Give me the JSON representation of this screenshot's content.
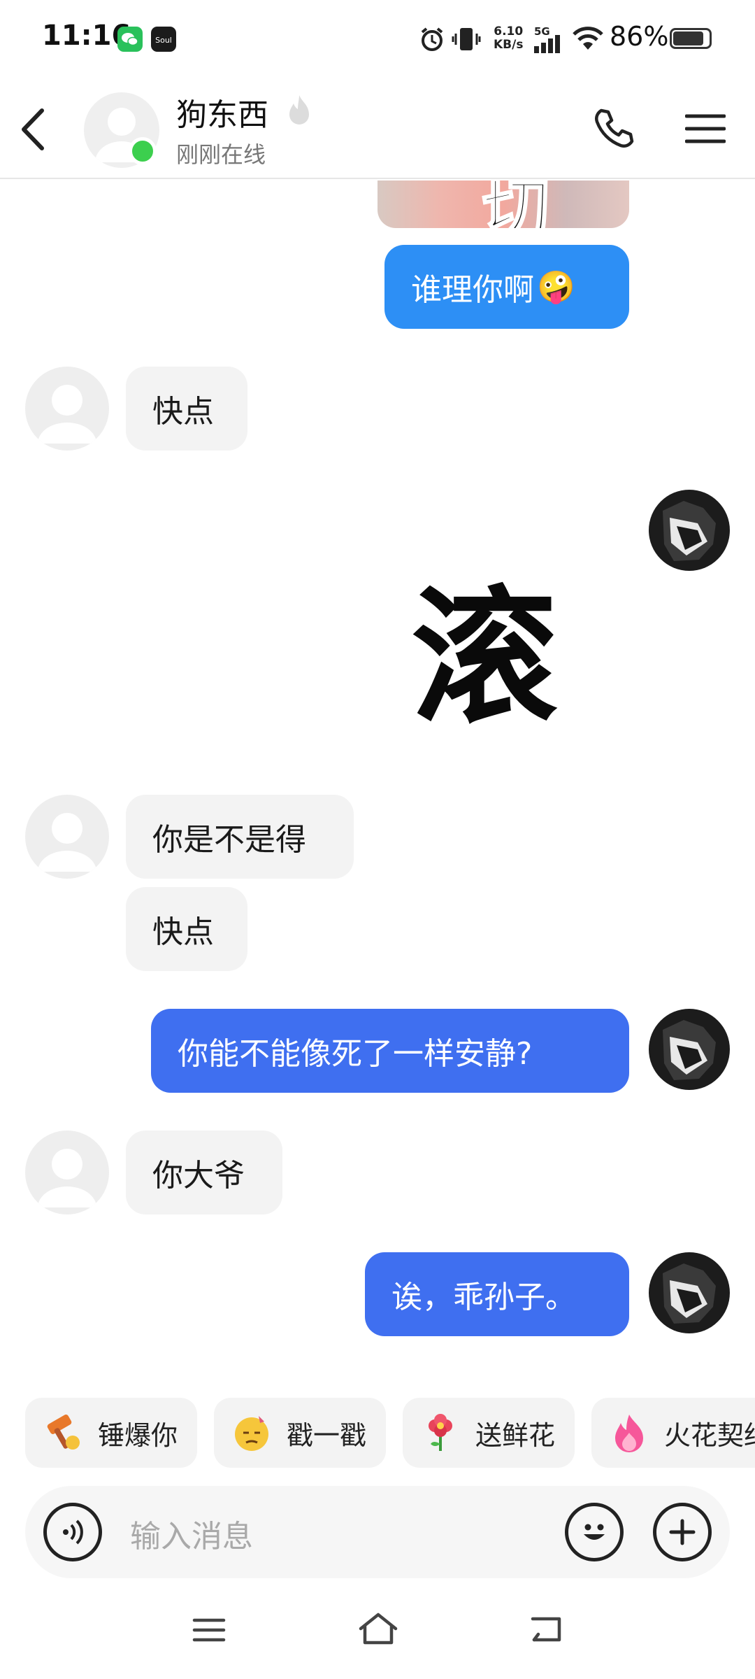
{
  "status_bar": {
    "time": "11:16",
    "net_speed_value": "6.10",
    "net_speed_unit": "KB/s",
    "network_type": "5G",
    "battery_text": "86%",
    "battery_level": 0.86,
    "apps": [
      "wechat-icon",
      "soul-icon"
    ]
  },
  "header": {
    "contact_name": "狗东西",
    "contact_status": "刚刚在线",
    "icons": [
      "back-icon",
      "phone-icon",
      "menu-icon",
      "fire-icon"
    ]
  },
  "messages": [
    {
      "side": "out",
      "type": "image-partial",
      "text": "切"
    },
    {
      "side": "out",
      "type": "text",
      "text": "谁理你啊",
      "emoji": "🤪"
    },
    {
      "side": "in",
      "type": "text",
      "text": "快点"
    },
    {
      "side": "out",
      "type": "sticker",
      "text": "滚"
    },
    {
      "side": "in",
      "type": "text",
      "text": "你是不是得"
    },
    {
      "side": "in",
      "type": "text",
      "text": "快点"
    },
    {
      "side": "out",
      "type": "text",
      "text": "你能不能像死了一样安静?"
    },
    {
      "side": "in",
      "type": "text",
      "text": "你大爷"
    },
    {
      "side": "out",
      "type": "text",
      "text": "诶，乖孙子。"
    }
  ],
  "quick_actions": [
    {
      "label": "锤爆你",
      "icon": "hammer-emoji-icon"
    },
    {
      "label": "戳一戳",
      "icon": "poke-face-icon"
    },
    {
      "label": "送鲜花",
      "icon": "flower-icon"
    },
    {
      "label": "火花契约",
      "icon": "flame-icon"
    }
  ],
  "input": {
    "placeholder": "输入消息"
  },
  "colors": {
    "bubble_in": "#f3f3f3",
    "bubble_out_light": "#2d8ff5",
    "bubble_out_dark": "#3f6ff0",
    "online": "#3ccf4e"
  }
}
